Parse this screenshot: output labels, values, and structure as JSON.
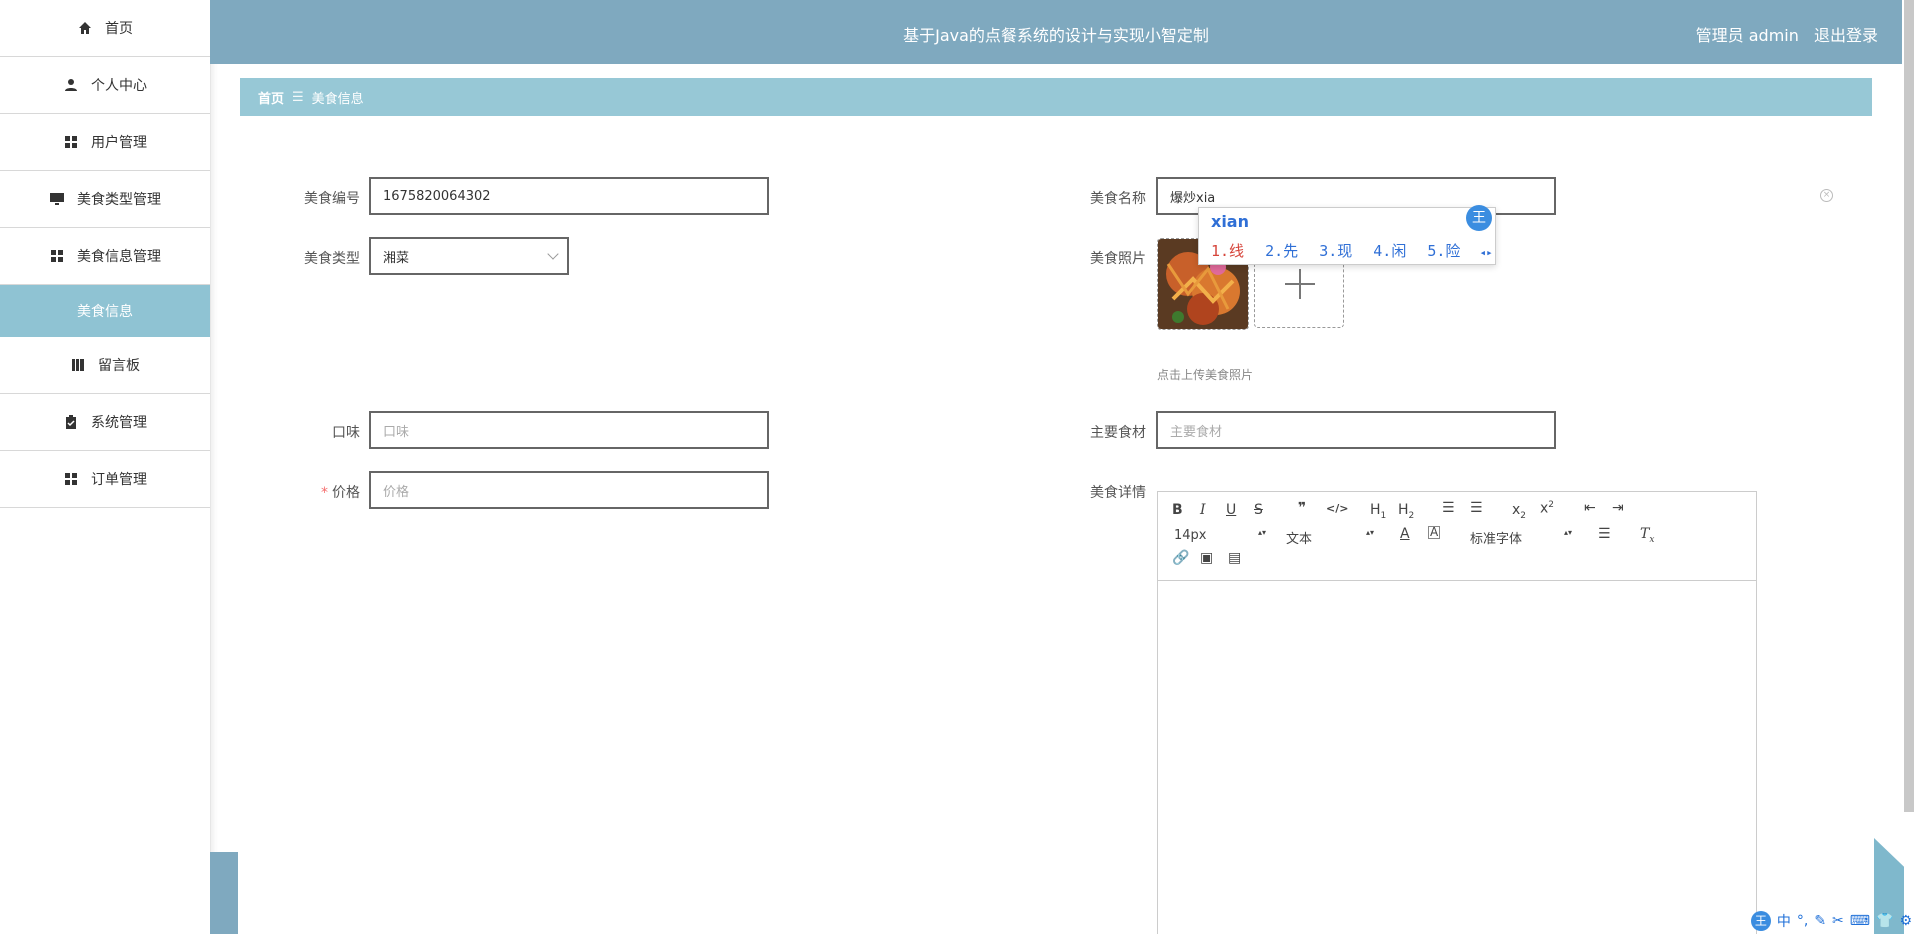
{
  "sidebar": {
    "items": [
      {
        "label": "首页",
        "icon": "home-icon"
      },
      {
        "label": "个人中心",
        "icon": "user-icon"
      },
      {
        "label": "用户管理",
        "icon": "grid-icon"
      },
      {
        "label": "美食类型管理",
        "icon": "monitor-icon"
      },
      {
        "label": "美食信息管理",
        "icon": "grid-icon"
      },
      {
        "label": "留言板",
        "icon": "book-icon"
      },
      {
        "label": "系统管理",
        "icon": "clipboard-icon"
      },
      {
        "label": "订单管理",
        "icon": "grid-icon"
      }
    ],
    "active_sub": "美食信息"
  },
  "header": {
    "title": "基于Java的点餐系统的设计与实现小智定制",
    "user_role": "管理员 admin",
    "logout": "退出登录"
  },
  "breadcrumb": {
    "home": "首页",
    "separator": "☰",
    "current": "美食信息"
  },
  "form": {
    "food_no": {
      "label": "美食编号",
      "value": "1675820064302"
    },
    "food_name": {
      "label": "美食名称",
      "value": "爆炒xia"
    },
    "food_type": {
      "label": "美食类型",
      "value": "湘菜"
    },
    "food_photo": {
      "label": "美食照片",
      "hint": "点击上传美食照片"
    },
    "taste": {
      "label": "口味",
      "placeholder": "口味"
    },
    "ingredients": {
      "label": "主要食材",
      "placeholder": "主要食材"
    },
    "price": {
      "label": "价格",
      "placeholder": "价格",
      "required_mark": "*"
    },
    "detail": {
      "label": "美食详情"
    }
  },
  "editor": {
    "font_size": "14px",
    "text_type": "文本",
    "font_family": "标准字体"
  },
  "ime": {
    "pinyin": "xian",
    "candidates": [
      "1.线",
      "2.先",
      "3.现",
      "4.闲",
      "5.险"
    ],
    "badge": "王"
  },
  "taskbar": {
    "lang": "中"
  },
  "colors": {
    "header_bg": "#7fa9bf",
    "breadcrumb_bg": "#97c8d6",
    "active_sub_bg": "#8fc3d3",
    "required": "#f56c6c"
  }
}
